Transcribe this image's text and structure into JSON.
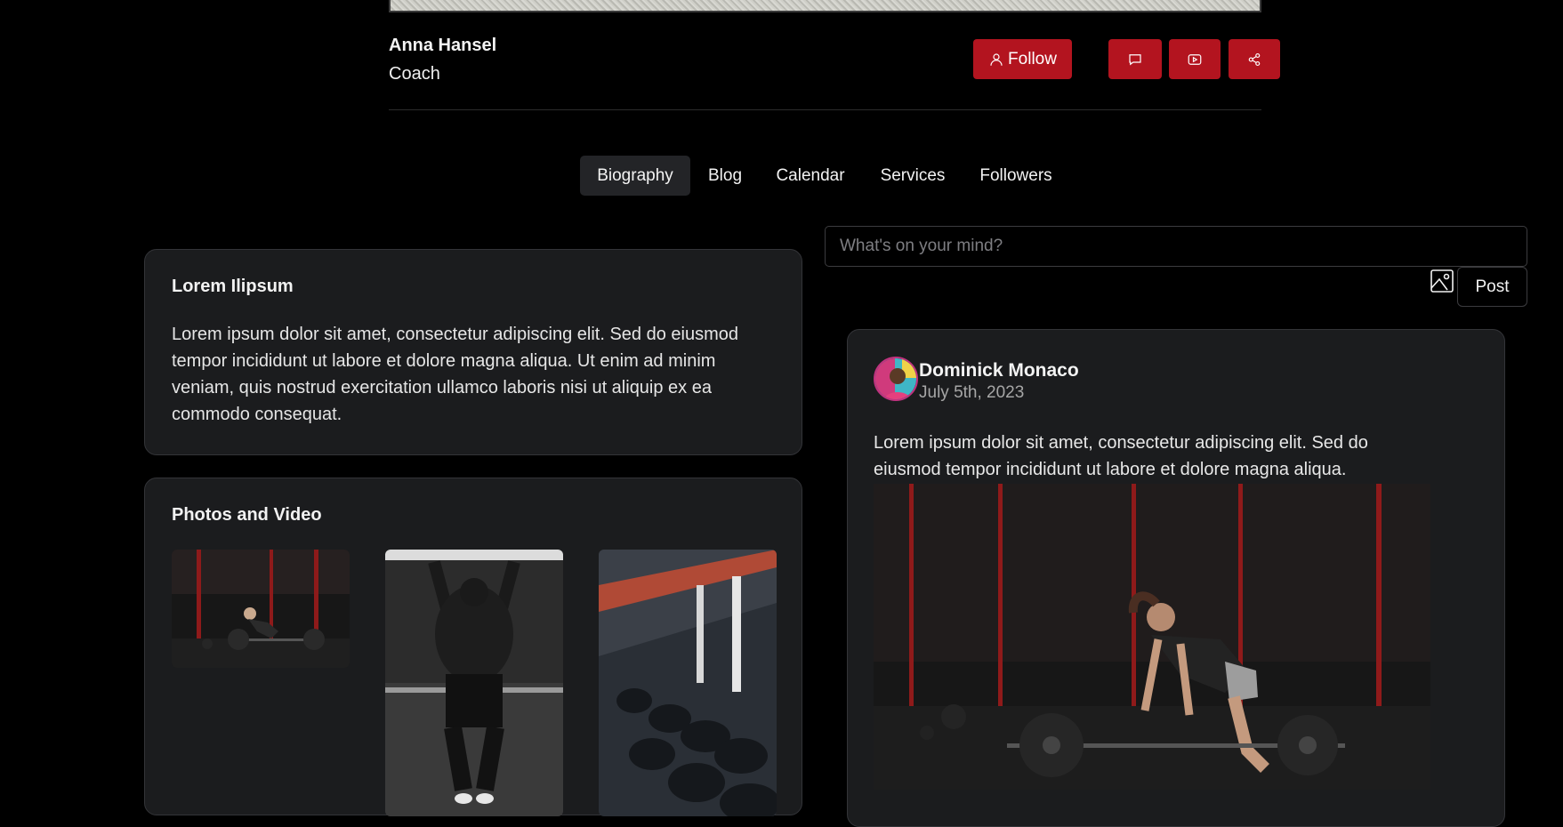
{
  "profile": {
    "name": "Anna Hansel",
    "role": "Coach",
    "follow_label": "Follow"
  },
  "tabs": [
    {
      "label": "Biography",
      "active": true
    },
    {
      "label": "Blog",
      "active": false
    },
    {
      "label": "Calendar",
      "active": false
    },
    {
      "label": "Services",
      "active": false
    },
    {
      "label": "Followers",
      "active": false
    }
  ],
  "bio_card": {
    "title": "Lorem Ilipsum",
    "text": "Lorem ipsum dolor sit amet, consectetur adipiscing elit. Sed do eiusmod tempor incididunt ut labore et dolore magna aliqua. Ut enim ad minim veniam, quis nostrud exercitation ullamco laboris nisi ut aliquip ex ea commodo consequat."
  },
  "media_card": {
    "title": "Photos and Video",
    "items": [
      "deadlift-photo",
      "pullup-photo",
      "dumbbell-rack-photo"
    ]
  },
  "composer": {
    "placeholder": "What's on your mind?",
    "post_label": "Post"
  },
  "feed_post": {
    "author": "Dominick Monaco",
    "date": "July 5th, 2023",
    "text": "Lorem ipsum dolor sit amet, consectetur adipiscing elit. Sed do eiusmod tempor incididunt ut labore et dolore magna aliqua."
  },
  "icons": {
    "follow": "user-icon",
    "message": "chat-icon",
    "video": "video-play-icon",
    "share": "share-icon",
    "attach": "image-icon"
  },
  "colors": {
    "accent": "#b3141f",
    "background": "#000000",
    "card": "#1b1c1e"
  }
}
